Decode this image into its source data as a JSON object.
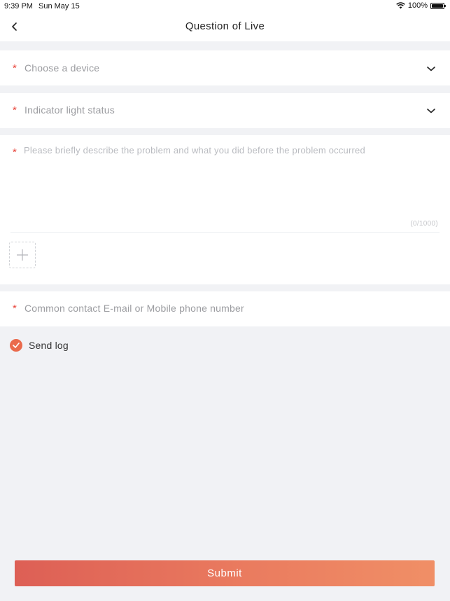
{
  "status_bar": {
    "time": "9:39 PM",
    "date": "Sun May 15",
    "battery": "100%"
  },
  "nav": {
    "title": "Question of Live"
  },
  "form": {
    "required_mark": "*",
    "device": {
      "placeholder": "Choose a device"
    },
    "indicator": {
      "placeholder": "Indicator light status"
    },
    "description": {
      "placeholder": "Please briefly describe the problem and what you did before the problem occurred",
      "counter": "(0/1000)"
    },
    "contact": {
      "placeholder": "Common contact E-mail or Mobile phone number"
    },
    "send_log": {
      "label": "Send log",
      "checked": true
    }
  },
  "submit_label": "Submit",
  "colors": {
    "accent": "#ea6a4c",
    "required": "#e8463c",
    "gradient_start": "#dd5f55",
    "gradient_end": "#f08f66"
  },
  "icons": [
    "back-chevron-icon",
    "chevron-down-icon",
    "plus-icon",
    "check-icon",
    "wifi-icon",
    "battery-icon"
  ]
}
